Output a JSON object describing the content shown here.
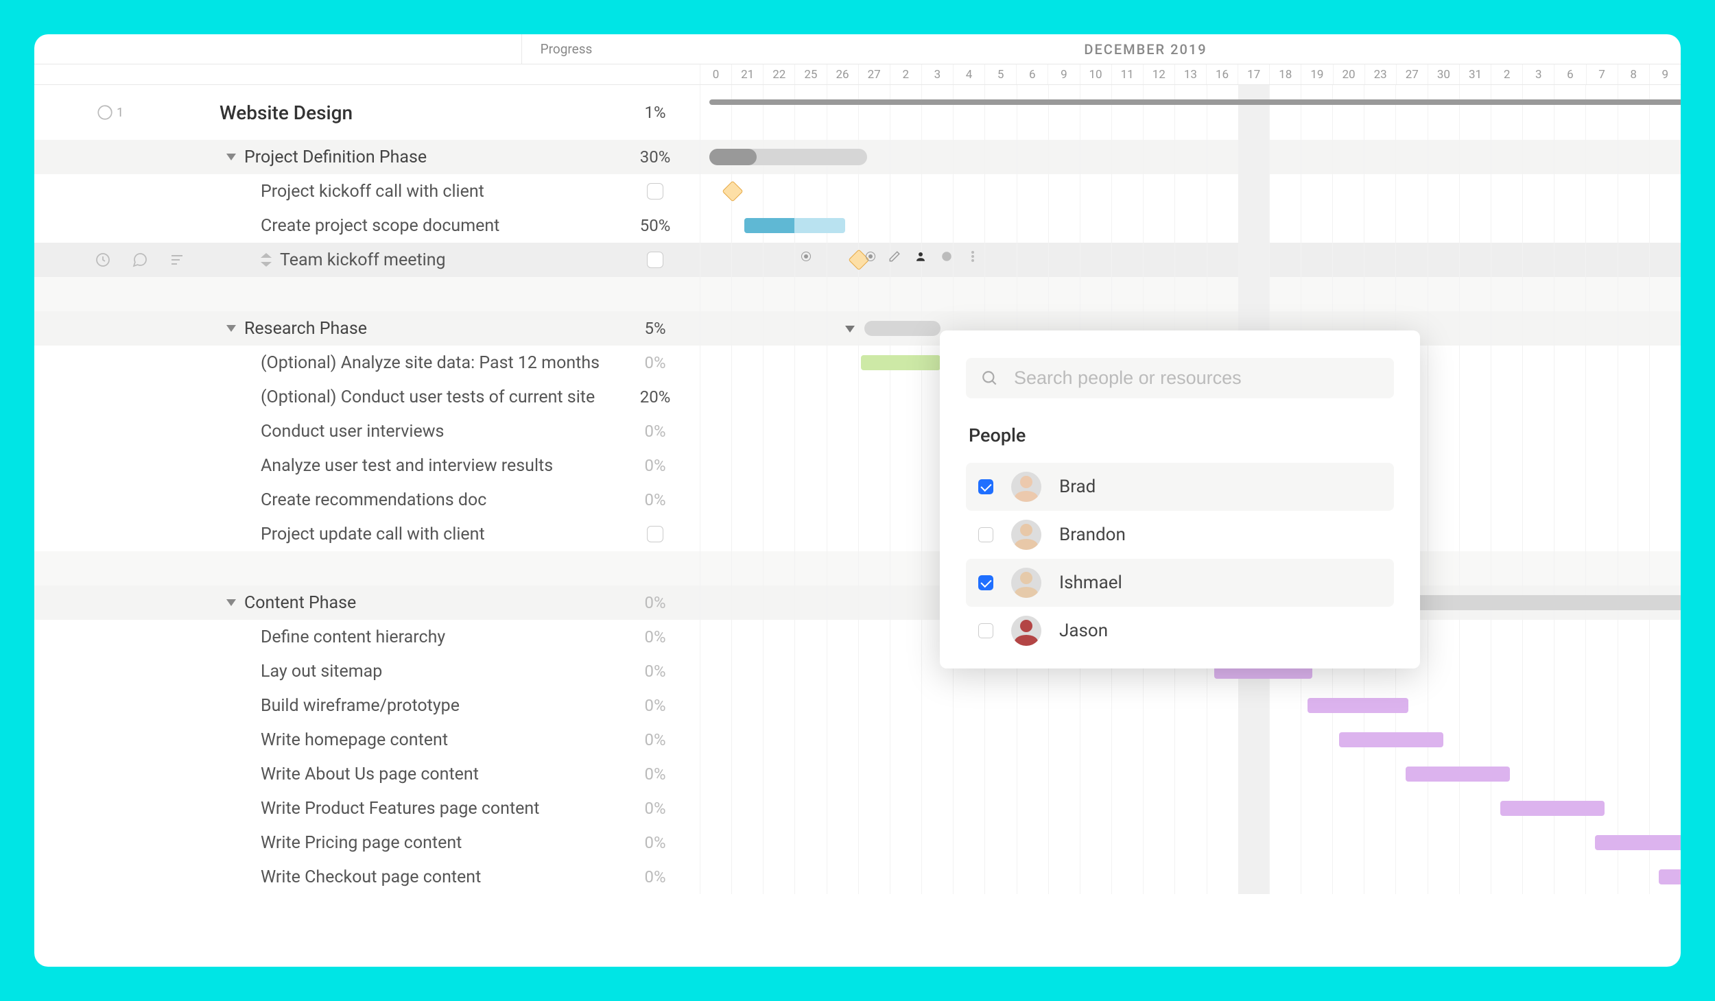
{
  "header": {
    "progress_label": "Progress",
    "month_label": "DECEMBER 2019",
    "days": [
      "0",
      "21",
      "22",
      "25",
      "26",
      "27",
      "2",
      "3",
      "4",
      "5",
      "6",
      "9",
      "10",
      "11",
      "12",
      "13",
      "16",
      "17",
      "18",
      "19",
      "20",
      "23",
      "27",
      "30",
      "31",
      "2",
      "3",
      "6",
      "7",
      "8",
      "9"
    ],
    "today_index": 17
  },
  "project": {
    "title": "Website Design",
    "progress": "1%",
    "icon_badge": "1"
  },
  "rows": [
    {
      "type": "phase",
      "label": "Project Definition Phase",
      "progress": "30%"
    },
    {
      "type": "task",
      "label": "Project kickoff call with client",
      "progress": "checkbox"
    },
    {
      "type": "task",
      "label": "Create project scope document",
      "progress": "50%"
    },
    {
      "type": "task",
      "label": "Team kickoff meeting",
      "progress": "checkbox",
      "selected": true
    },
    {
      "type": "blank"
    },
    {
      "type": "phase",
      "label": "Research Phase",
      "progress": "5%"
    },
    {
      "type": "task",
      "label": "(Optional) Analyze site data: Past 12 months",
      "progress": "0%"
    },
    {
      "type": "task",
      "label": "(Optional) Conduct user tests of current site",
      "progress": "20%"
    },
    {
      "type": "task",
      "label": "Conduct user interviews",
      "progress": "0%"
    },
    {
      "type": "task",
      "label": "Analyze user test and interview results",
      "progress": "0%"
    },
    {
      "type": "task",
      "label": "Create recommendations doc",
      "progress": "0%"
    },
    {
      "type": "task",
      "label": "Project update call with client",
      "progress": "checkbox"
    },
    {
      "type": "blank"
    },
    {
      "type": "phase",
      "label": "Content Phase",
      "progress": "0%"
    },
    {
      "type": "task",
      "label": "Define content hierarchy",
      "progress": "0%"
    },
    {
      "type": "task",
      "label": "Lay out sitemap",
      "progress": "0%"
    },
    {
      "type": "task",
      "label": "Build wireframe/prototype",
      "progress": "0%"
    },
    {
      "type": "task",
      "label": "Write homepage content",
      "progress": "0%"
    },
    {
      "type": "task",
      "label": "Write About Us page content",
      "progress": "0%"
    },
    {
      "type": "task",
      "label": "Write Product Features page content",
      "progress": "0%"
    },
    {
      "type": "task",
      "label": "Write Pricing page content",
      "progress": "0%"
    },
    {
      "type": "task",
      "label": "Write Checkout page content",
      "progress": "0%"
    }
  ],
  "popover": {
    "search_placeholder": "Search people or resources",
    "section_title": "People",
    "people": [
      {
        "name": "Brad",
        "checked": true
      },
      {
        "name": "Brandon",
        "checked": false
      },
      {
        "name": "Ishmael",
        "checked": true
      },
      {
        "name": "Jason",
        "checked": false
      }
    ]
  },
  "colors": {
    "accent_cyan": "#00e5e5",
    "bar_blue": "#5fb8d4",
    "bar_green": "#cde9a6",
    "bar_purple": "#dcb3ee",
    "milestone": "#fddfa6",
    "checkbox_blue": "#1f6fff"
  }
}
